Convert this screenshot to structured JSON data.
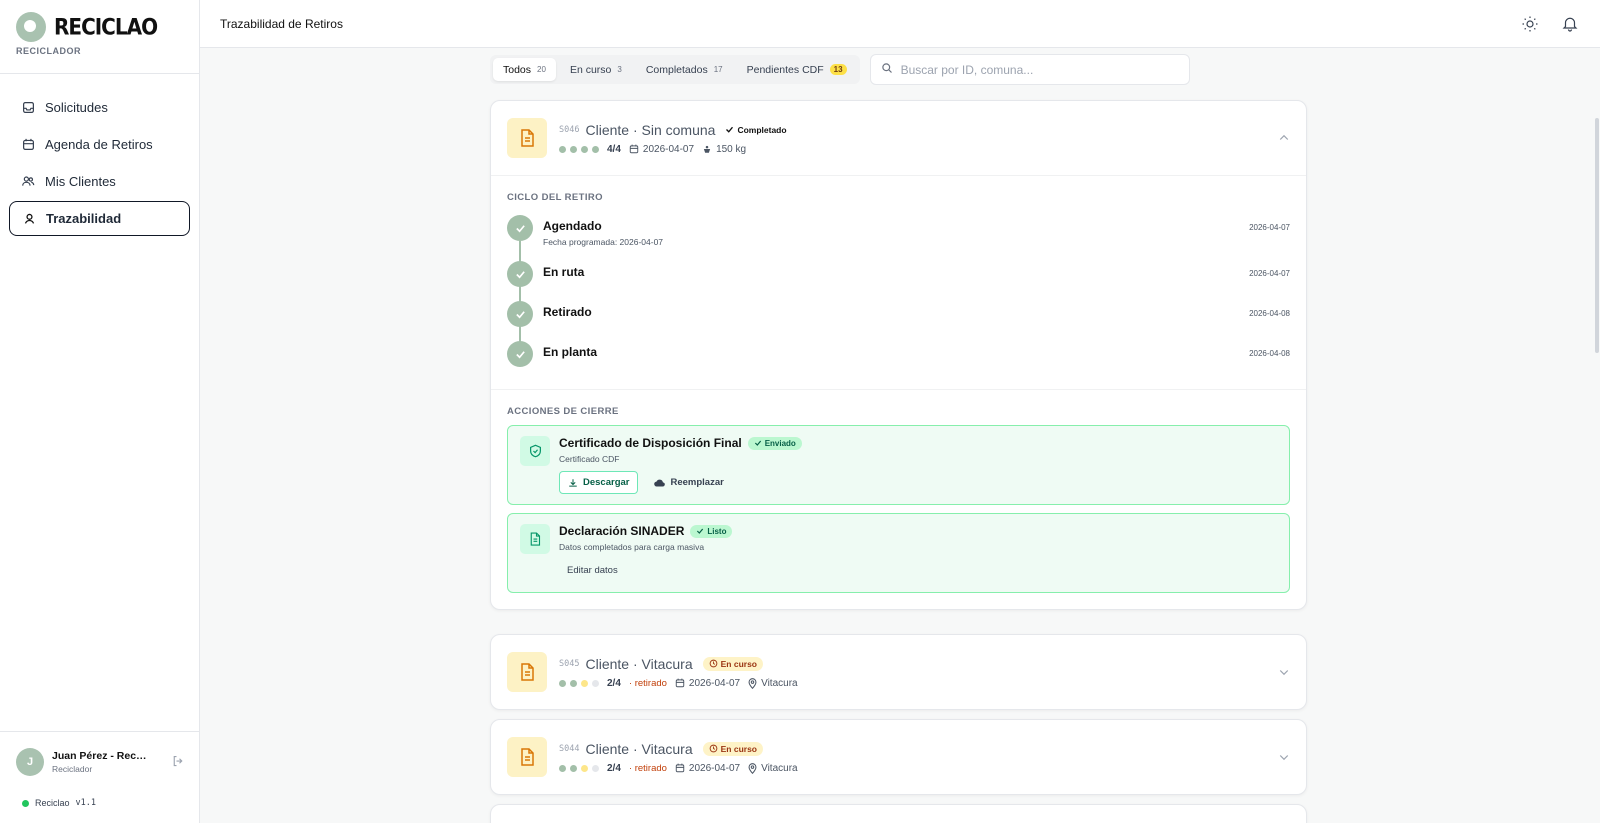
{
  "brand": {
    "name": "RECICLAO",
    "role": "RECICLADOR"
  },
  "nav": [
    {
      "label": "Solicitudes",
      "icon": "inbox-icon"
    },
    {
      "label": "Agenda de Retiros",
      "icon": "calendar-icon"
    },
    {
      "label": "Mis Clientes",
      "icon": "users-icon"
    },
    {
      "label": "Trazabilidad",
      "icon": "location-user-icon",
      "active": true
    }
  ],
  "user": {
    "initial": "J",
    "name": "Juan Pérez - Recicl...",
    "role": "Reciclador"
  },
  "version": {
    "app": "Reciclao",
    "code": "v1.1"
  },
  "topbar": {
    "title": "Trazabilidad de Retiros"
  },
  "filters": {
    "tabs": [
      {
        "label": "Todos",
        "count": "20"
      },
      {
        "label": "En curso",
        "count": "3"
      },
      {
        "label": "Completados",
        "count": "17"
      },
      {
        "label": "Pendientes CDF",
        "count": "13"
      }
    ],
    "search_placeholder": "Buscar por ID, comuna..."
  },
  "cards": [
    {
      "id": "S046",
      "title": "Cliente · Sin comuna",
      "status": "Completado",
      "progress": "4/4",
      "date": "2026-04-07",
      "weight": "150 kg",
      "cycle_label": "CICLO DEL RETIRO",
      "steps": [
        {
          "title": "Agendado",
          "sub": "Fecha programada: 2026-04-07",
          "date": "2026-04-07"
        },
        {
          "title": "En ruta",
          "sub": "",
          "date": "2026-04-07"
        },
        {
          "title": "Retirado",
          "sub": "",
          "date": "2026-04-08"
        },
        {
          "title": "En planta",
          "sub": "",
          "date": "2026-04-08"
        }
      ],
      "actions_label": "ACCIONES DE CIERRE",
      "actions": [
        {
          "title": "Certificado de Disposición Final",
          "badge": "Enviado",
          "sub": "Certificado CDF",
          "primary": "Descargar",
          "secondary": "Reemplazar"
        },
        {
          "title": "Declaración SINADER",
          "badge": "Listo",
          "sub": "Datos completados para carga masiva",
          "secondary": "Editar datos"
        }
      ]
    },
    {
      "id": "S045",
      "title": "Cliente · Vitacura",
      "status": "En curso",
      "progress": "2/4",
      "stage": "· retirado",
      "date": "2026-04-07",
      "place": "Vitacura"
    },
    {
      "id": "S044",
      "title": "Cliente · Vitacura",
      "status": "En curso",
      "progress": "2/4",
      "stage": "· retirado",
      "date": "2026-04-07",
      "place": "Vitacura"
    }
  ]
}
